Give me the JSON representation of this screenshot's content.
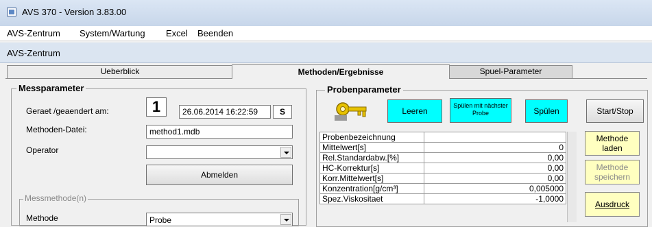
{
  "window": {
    "title": "AVS 370 - Version 3.83.00"
  },
  "menu": [
    {
      "label": "AVS-Zentrum"
    },
    {
      "label": "System/Wartung"
    },
    {
      "label": "Excel"
    },
    {
      "label": "Beenden"
    }
  ],
  "subwindow": {
    "title": "AVS-Zentrum"
  },
  "tabs": [
    {
      "label": "Ueberblick"
    },
    {
      "label": "Methoden/Ergebnisse"
    },
    {
      "label": "Spuel-Parameter"
    }
  ],
  "messparameter": {
    "title": "Messparameter",
    "geraet_label": "Geraet /geaendert am:",
    "geraet_number": "1",
    "datetime": "26.06.2014 16:22:59",
    "mode": "S",
    "methoden_datei_label": "Methoden-Datei:",
    "methoden_datei_value": "method1.mdb",
    "operator_label": "Operator",
    "operator_value": "",
    "abmelden_label": "Abmelden",
    "messmethode_title": "Messmethode(n)",
    "methode_label": "Methode",
    "methode_value": "Probe"
  },
  "probenparameter": {
    "title": "Probenparameter",
    "key_icon": "key-icon",
    "leeren_label": "Leeren",
    "spuelen_naechste_label": "Spülen mit nächster Probe",
    "spuelen_label": "Spülen",
    "startstop_label": "Start/Stop",
    "methode_laden_label": "Methode laden",
    "methode_speichern_label": "Methode speichern",
    "ausdruck_label": "Ausdruck",
    "rows": [
      {
        "name": "Probenbezeichnung",
        "value": ""
      },
      {
        "name": "Mittelwert[s]",
        "value": "0"
      },
      {
        "name": "Rel.Standardabw.[%]",
        "value": "0,00"
      },
      {
        "name": "HC-Korrektur[s]",
        "value": "0,00"
      },
      {
        "name": "Korr.Mittelwert[s]",
        "value": "0,00"
      },
      {
        "name": "Konzentration[g/cm³]",
        "value": "0,005000"
      },
      {
        "name": "Spez.Viskositaet",
        "value": "-1,0000"
      }
    ]
  },
  "colors": {
    "cyan_button": "#00ffff",
    "yellow_button": "#ffffc0",
    "title_bg": "#dbe6f4"
  }
}
